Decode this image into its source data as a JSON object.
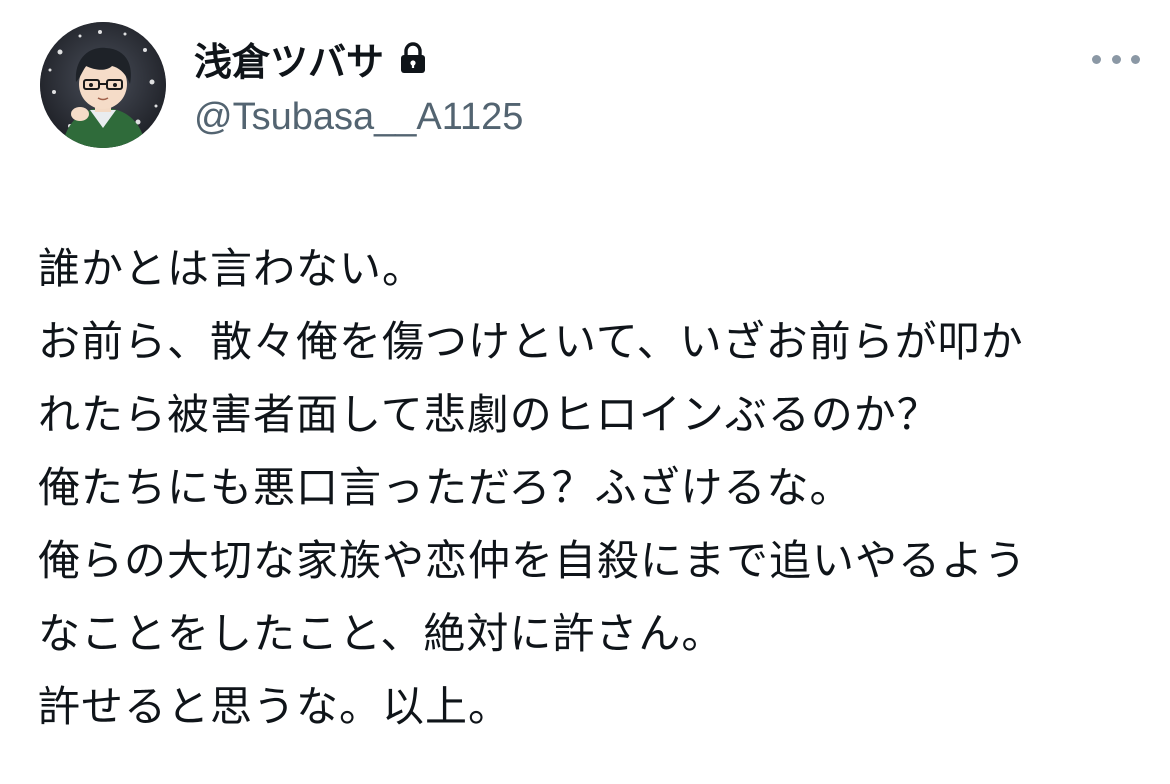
{
  "tweet": {
    "author": {
      "display_name": "浅倉ツバサ",
      "handle": "@Tsubasa__A1125",
      "protected_icon": "lock-icon",
      "avatar": "avatar-image"
    },
    "more_icon": "more-horizontal-icon",
    "lines": [
      "誰かとは言わない。",
      "お前ら、散々俺を傷つけといて、いざお前らが叩か",
      "れたら被害者面して悲劇のヒロインぶるのか？",
      "俺たちにも悪口言っただろ？ふざけるな。",
      "俺らの大切な家族や恋仲を自殺にまで追いやるよう",
      "なことをしたこと、絶対に許さん。",
      "許せると思うな。以上。"
    ]
  },
  "colors": {
    "text": "#0f1419",
    "secondary": "#536471",
    "background": "#ffffff",
    "dots": "#8b98a5"
  }
}
